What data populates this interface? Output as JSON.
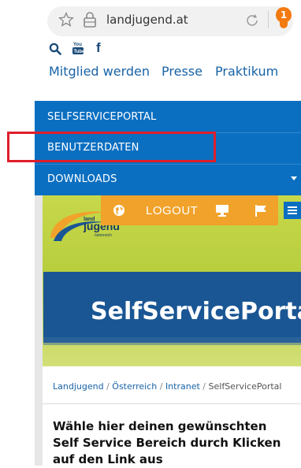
{
  "browser": {
    "url": "landjugend.at",
    "notification_count": "1"
  },
  "social": {
    "icons": [
      "search-icon",
      "youtube-icon",
      "facebook-icon"
    ],
    "youtube_text": "You Tube",
    "facebook_text": "f"
  },
  "top_nav": [
    "Mitglied werden",
    "Presse",
    "Praktikum"
  ],
  "menu": {
    "items": [
      "SELFSERVICEPORTAL",
      "BENUTZERDATEN",
      "DOWNLOADS"
    ]
  },
  "toolbar": {
    "logout_label": "LOGOUT",
    "icons": [
      "globe-icon",
      "monitor-icon",
      "flag-icon",
      "hamburger-icon"
    ]
  },
  "logo": {
    "text_land": "land",
    "text_jugend": "jugend",
    "text_country": "österreich"
  },
  "hero": {
    "title": "SelfServicePortal"
  },
  "breadcrumb": {
    "items": [
      "Landjugend",
      "Österreich",
      "Intranet",
      "SelfServicePortal"
    ],
    "separator": "/"
  },
  "headline": "Wähle hier deinen gewünschten Self Service Bereich durch Klicken auf den Link aus",
  "colors": {
    "menu_blue": "#0b6fc1",
    "orange": "#f0a22a",
    "highlight_red": "#e01e2a",
    "title_blue": "#1a5694",
    "hero_green": "#c7d84a"
  }
}
